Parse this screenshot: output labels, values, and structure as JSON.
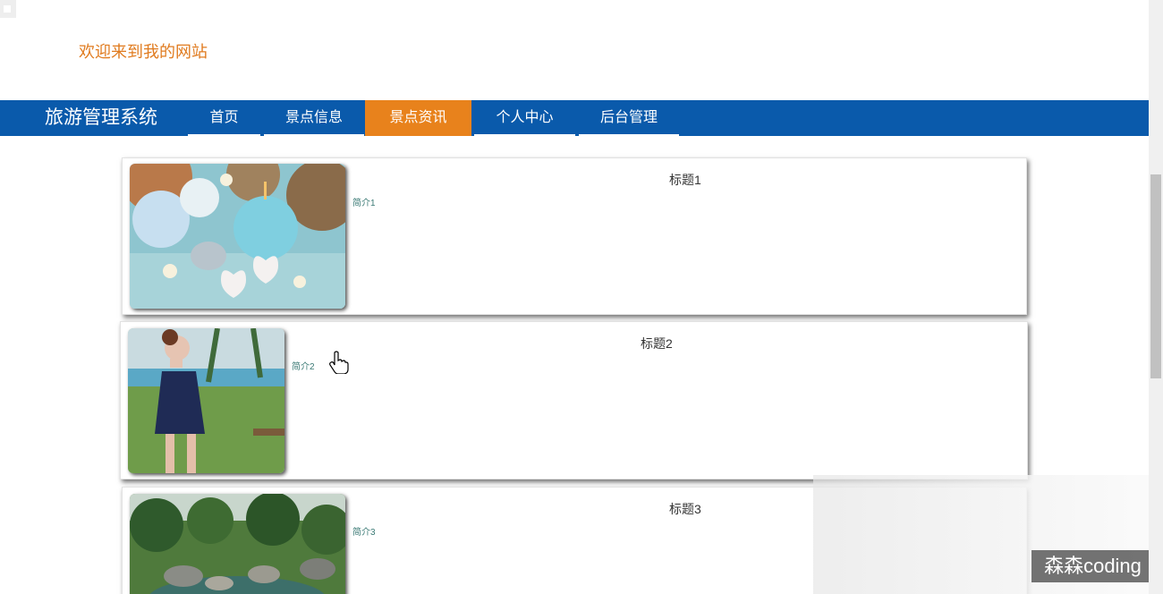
{
  "header": {
    "welcome_text": "欢迎来到我的网站"
  },
  "nav": {
    "brand": "旅游管理系统",
    "items": [
      {
        "label": "首页",
        "active": false
      },
      {
        "label": "景点信息",
        "active": false
      },
      {
        "label": "景点资讯",
        "active": true
      },
      {
        "label": "个人中心",
        "active": false
      },
      {
        "label": "后台管理",
        "active": false
      }
    ],
    "colors": {
      "bar": "#0a5aab",
      "active": "#e8821c",
      "welcome": "#e07b1f"
    }
  },
  "news": [
    {
      "title": "标题1",
      "summary": "简介1",
      "image": "spa-candles-photo"
    },
    {
      "title": "标题2",
      "summary": "简介2",
      "image": "poolside-woman-photo"
    },
    {
      "title": "标题3",
      "summary": "简介3",
      "image": "garden-pond-photo"
    }
  ],
  "watermark": "森森coding"
}
